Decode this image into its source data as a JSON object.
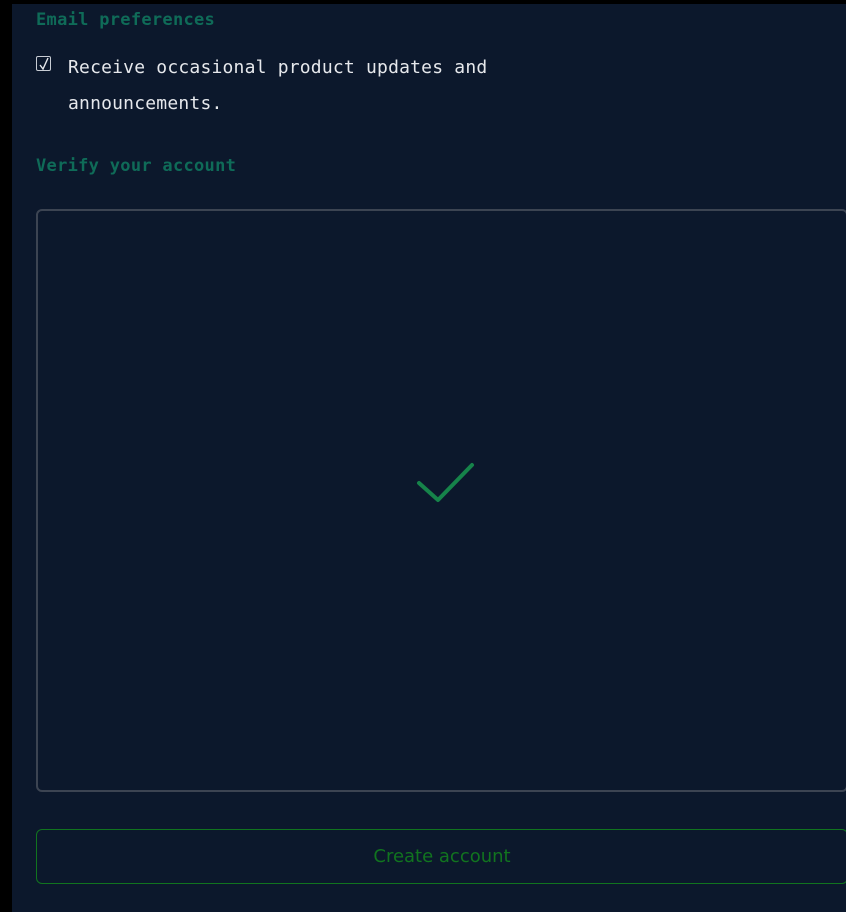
{
  "email_preferences": {
    "title": "Email preferences",
    "checkbox_checked": true,
    "checkbox_label": "Receive occasional product updates and announcements."
  },
  "verify": {
    "title": "Verify your account",
    "status_icon": "checkmark-icon",
    "status_color": "#16834a"
  },
  "actions": {
    "create_account_label": "Create account",
    "button_color": "#11741f"
  },
  "colors": {
    "background": "#0c182c",
    "section_title": "#0f6b58",
    "text": "#e6e8ec"
  }
}
